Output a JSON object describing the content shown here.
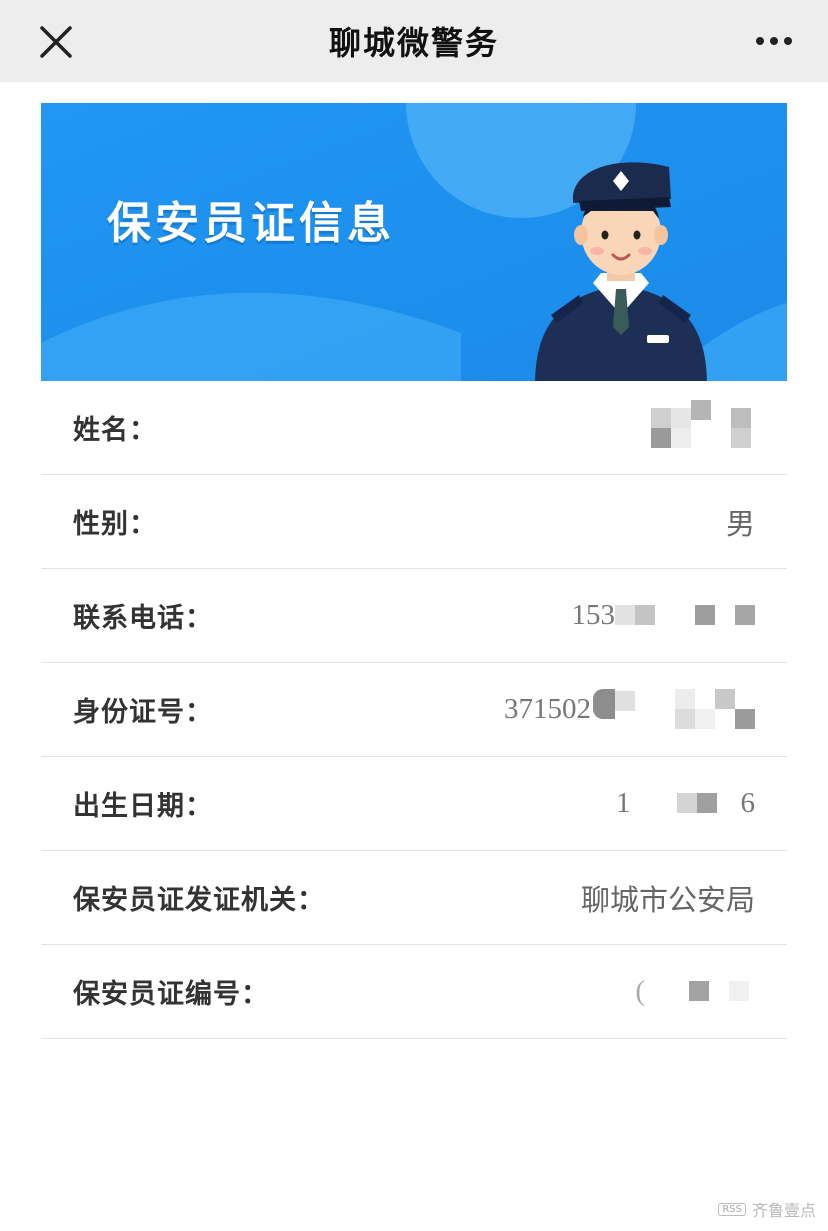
{
  "header": {
    "title": "聊城微警务",
    "close_icon": "close-icon",
    "more_icon": "more-horizontal-icon"
  },
  "banner": {
    "title": "保安员证信息",
    "background_color": "#1f8ef0",
    "illustration": "security-guard-avatar"
  },
  "fields": [
    {
      "label": "姓名：",
      "value": ""
    },
    {
      "label": "性别：",
      "value": "男"
    },
    {
      "label": "联系电话：",
      "value": "153"
    },
    {
      "label": "身份证号：",
      "value": "371502"
    },
    {
      "label": "出生日期：",
      "value_start": "1",
      "value_end": "6"
    },
    {
      "label": "保安员证发证机关：",
      "value": "聊城市公安局"
    },
    {
      "label": "保安员证编号：",
      "value": "("
    }
  ],
  "watermark": {
    "text": "齐鲁壹点",
    "badge": "RSS"
  }
}
